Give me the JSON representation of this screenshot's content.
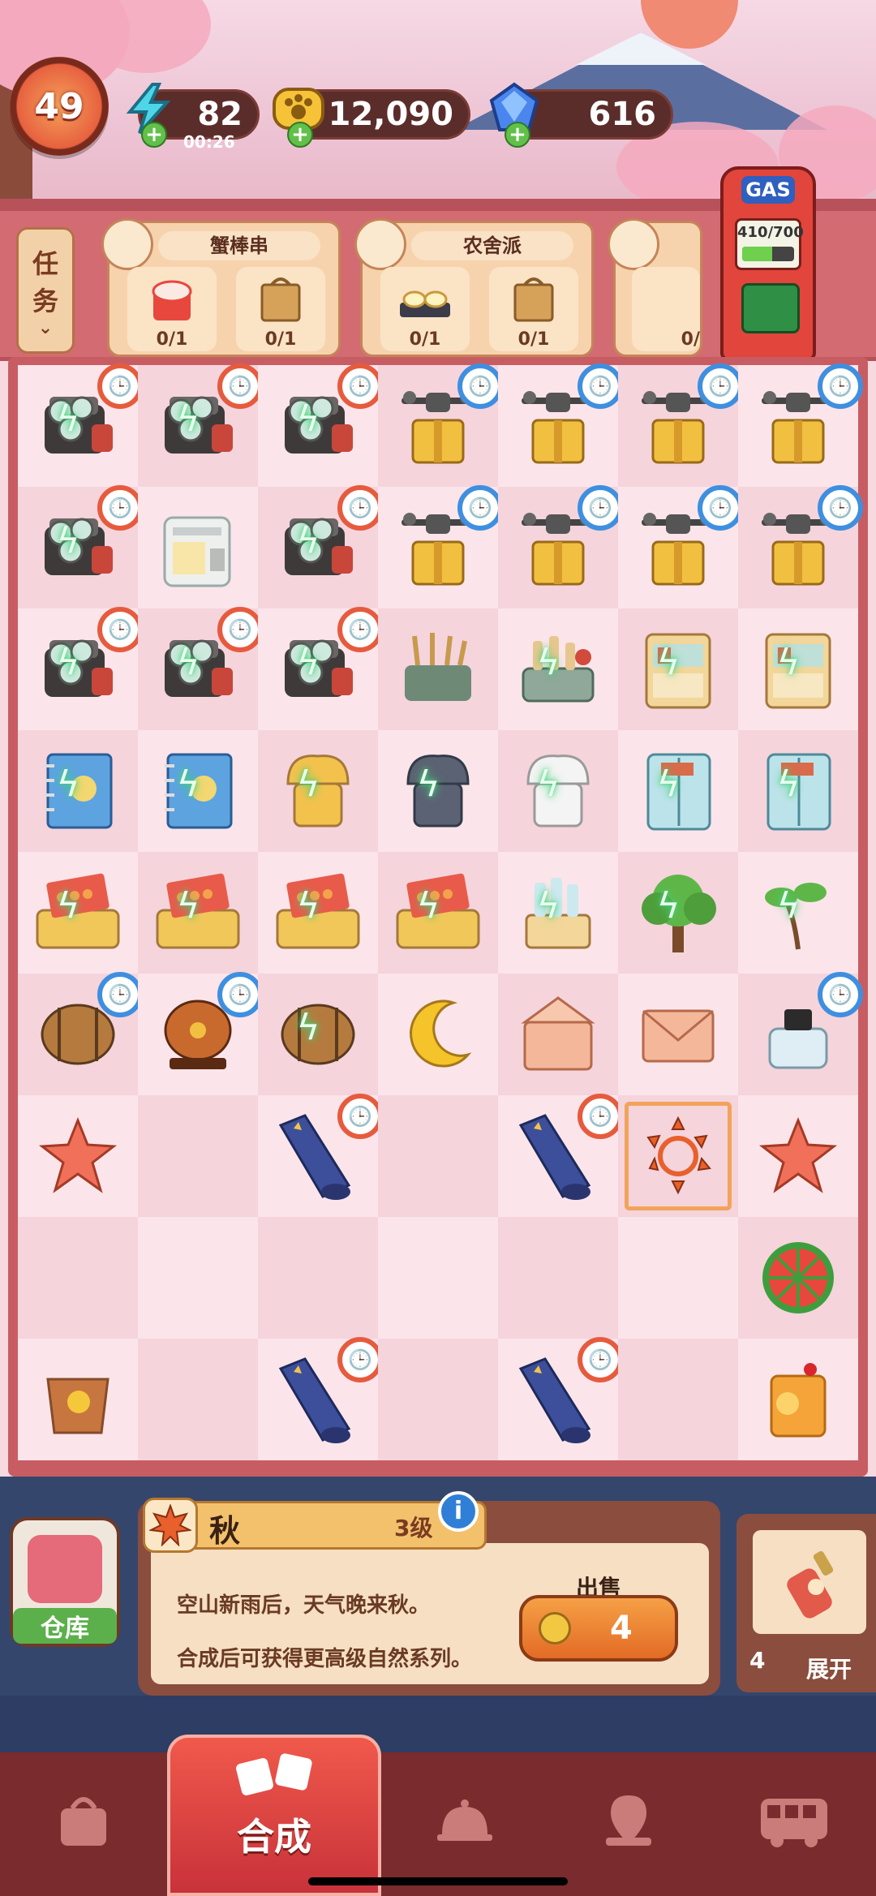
{
  "header": {
    "level": "49",
    "energy": "82",
    "energy_timer": "00:26",
    "coins": "12,090",
    "gems": "616"
  },
  "tasks_tab": {
    "label_line1": "任",
    "label_line2": "务"
  },
  "orders": [
    {
      "title": "蟹棒串",
      "slots": [
        "0/1",
        "0/1"
      ]
    },
    {
      "title": "农舍派",
      "slots": [
        "0/1",
        "0/1"
      ]
    },
    {
      "title": "",
      "slots": [
        "0/"
      ]
    }
  ],
  "gas_pump": {
    "label": "GAS",
    "value": "410/700",
    "current": 410,
    "max": 700
  },
  "board": {
    "rows": [
      [
        "camera-timer-bolt",
        "camera-timer-bolt",
        "camera-timer-bolt",
        "drone-box-timer",
        "drone-box-timer",
        "drone-box-timer",
        "drone-box-timer"
      ],
      [
        "camera-timer-bolt",
        "printer",
        "camera-timer-bolt",
        "drone-box-timer",
        "drone-box-timer",
        "drone-box-timer",
        "drone-box-timer"
      ],
      [
        "camera-timer-bolt",
        "camera-timer-bolt",
        "camera-timer-bolt",
        "bottle-rack",
        "sauce-cart-bolt",
        "shelf-cart-bolt",
        "shelf-cart-bolt"
      ],
      [
        "notebook-bolt",
        "notebook-bolt",
        "chef-hat-bolt",
        "chef-hat-bolt",
        "chef-hat-bolt",
        "cabinet-bolt",
        "cabinet-bolt"
      ],
      [
        "skewer-box-bolt",
        "skewer-box-bolt",
        "skewer-box-bolt",
        "skewer-box-bolt",
        "bottle-shelf-bolt",
        "tree-bolt",
        "sapling-bolt"
      ],
      [
        "barrel-timer",
        "keg-timer",
        "barrel-bolt",
        "moon",
        "envelope-open",
        "envelope",
        "inkwell-timer"
      ],
      [
        "star",
        "empty",
        "telescope-timer",
        "empty",
        "telescope-timer",
        "maple-wreath-selected",
        "star"
      ],
      [
        "empty",
        "empty",
        "empty",
        "empty",
        "empty",
        "empty",
        "watermelon"
      ],
      [
        "tea-glass",
        "empty",
        "telescope-timer",
        "empty",
        "telescope-timer",
        "empty",
        "orange-juice"
      ]
    ]
  },
  "selected_item": {
    "name": "秋",
    "level": "3级",
    "description_line1": "空山新雨后，天气晚来秋。",
    "description_line2": "合成后可获得更高级自然系列。",
    "sell_label": "出售",
    "sell_price": "4"
  },
  "storage": {
    "label": "仓库"
  },
  "expand": {
    "count": "4",
    "label": "展开"
  },
  "nav": {
    "merge_label": "合成"
  },
  "colors": {
    "board_frame": "#c75d63",
    "cell_light": "#fbe5ea",
    "cell_dark": "#f5d4dc",
    "timer_blue": "#3f8fe0",
    "timer_red": "#e65b3e",
    "nav_active": "#e04a42"
  }
}
